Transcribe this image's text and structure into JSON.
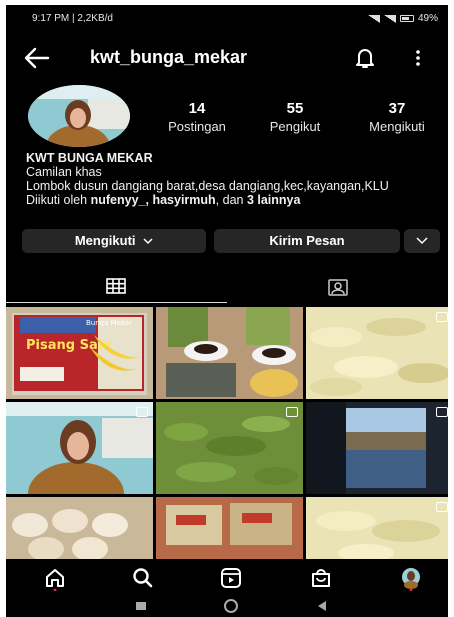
{
  "status_bar": {
    "time_info": "9:17 PM | 2,2KB/d",
    "battery": "49%"
  },
  "header": {
    "username": "kwt_bunga_mekar",
    "icons": [
      "back-arrow-icon",
      "bell-icon",
      "more-vertical-icon"
    ]
  },
  "profile": {
    "stats": [
      {
        "value": "14",
        "label": "Postingan"
      },
      {
        "value": "55",
        "label": "Pengikut"
      },
      {
        "value": "37",
        "label": "Mengikuti"
      }
    ],
    "display_name": "KWT BUNGA MEKAR",
    "category": "Camilan khas",
    "bio": "Lombok dusun dangiang barat,desa dangiang,kec,kayangan,KLU",
    "followed_by_prefix": "Diikuti oleh ",
    "followed_by_names": "nufenyy_, hasyirmuh",
    "followed_by_mid": ", dan ",
    "followed_by_count": "3 lainnya"
  },
  "actions": {
    "following_label": "Mengikuti",
    "message_label": "Kirim Pesan"
  },
  "grid": {
    "post_texts": {
      "pisang_sale": "Pisang Sale",
      "brand": "Bunga Mekar"
    }
  },
  "colors": {
    "background": "#000000",
    "button": "#262626",
    "text": "#ffffff"
  }
}
